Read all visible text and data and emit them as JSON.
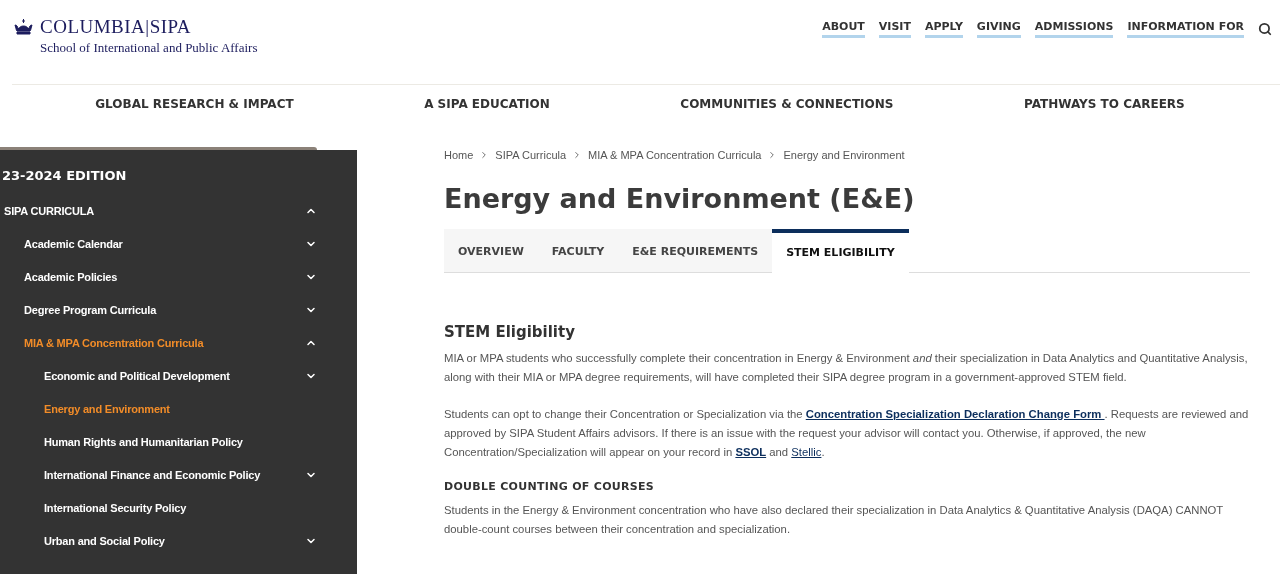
{
  "header": {
    "logo": {
      "wordmark": "COLUMBIA|SIPA",
      "subtitle": "School of International and Public Affairs"
    },
    "utility_nav": [
      "ABOUT",
      "VISIT",
      "APPLY",
      "GIVING",
      "ADMISSIONS",
      "INFORMATION FOR"
    ],
    "main_nav": [
      "GLOBAL RESEARCH & IMPACT",
      "A SIPA EDUCATION",
      "COMMUNITIES & CONNECTIONS",
      "PATHWAYS TO CAREERS"
    ]
  },
  "sidebar": {
    "edition": "23-2024 EDITION",
    "items": [
      {
        "label": "SIPA CURRICULA",
        "kind": "expandable",
        "expanded": true,
        "on_path": false,
        "children": [
          {
            "label": "Academic Calendar",
            "kind": "expandable",
            "expanded": false,
            "on_path": false
          },
          {
            "label": "Academic Policies",
            "kind": "expandable",
            "expanded": false,
            "on_path": false
          },
          {
            "label": "Degree Program Curricula",
            "kind": "expandable",
            "expanded": false,
            "on_path": false
          },
          {
            "label": "MIA & MPA Concentration Curricula",
            "kind": "expandable",
            "expanded": true,
            "on_path": true,
            "children": [
              {
                "label": "Economic and Political Development",
                "kind": "expandable",
                "expanded": false,
                "on_path": false
              },
              {
                "label": "Energy and Environment",
                "kind": "leaf",
                "on_path": true
              },
              {
                "label": "Human Rights and Humanitarian Policy",
                "kind": "leaf",
                "on_path": false
              },
              {
                "label": "International Finance and Economic Policy",
                "kind": "expandable",
                "expanded": false,
                "on_path": false
              },
              {
                "label": "International Security Policy",
                "kind": "leaf",
                "on_path": false
              },
              {
                "label": "Urban and Social Policy",
                "kind": "expandable",
                "expanded": false,
                "on_path": false
              }
            ]
          }
        ]
      }
    ]
  },
  "breadcrumb": [
    "Home",
    "SIPA Curricula",
    "MIA & MPA Concentration Curricula",
    "Energy and Environment"
  ],
  "title": "Energy and Environment (E&E)",
  "tabs": [
    {
      "label": "OVERVIEW",
      "selected": false
    },
    {
      "label": "FACULTY",
      "selected": false
    },
    {
      "label": "E&E REQUIREMENTS",
      "selected": false
    },
    {
      "label": "STEM ELIGIBILITY",
      "selected": true
    }
  ],
  "content": [
    {
      "kind": "heading",
      "text": "STEM Eligibility"
    },
    {
      "kind": "paragraph",
      "parts": [
        {
          "kind": "text",
          "text": "MIA or MPA students who successfully complete their concentration in Energy & Environment *and* their specialization in Data Analytics and Quantitative Analysis, along with their MIA or MPA degree requirements, will have completed their SIPA degree program in a government-approved STEM field."
        }
      ]
    },
    {
      "kind": "paragraph",
      "parts": [
        {
          "kind": "text",
          "text": "Students can opt to change their Concentration or Specialization via the "
        },
        {
          "kind": "link",
          "text": "Concentration Specialization Declaration Change Form ",
          "bold": true
        },
        {
          "kind": "text",
          "text": ". Requests are reviewed and approved by SIPA Student Affairs advisors. If there is an issue with the request your advisor will contact you. Otherwise, if approved, the new Concentration/Specialization will appear on your record in "
        },
        {
          "kind": "link",
          "text": "SSOL",
          "bold": true
        },
        {
          "kind": "text",
          "text": " and "
        },
        {
          "kind": "link",
          "text": "Stellic",
          "bold": false
        },
        {
          "kind": "text",
          "text": "."
        }
      ]
    },
    {
      "kind": "subheading",
      "text": "DOUBLE COUNTING OF COURSES"
    },
    {
      "kind": "paragraph",
      "parts": [
        {
          "kind": "text",
          "text": "Students in the Energy & Environment concentration who have also declared their specialization in Data Analytics & Quantitative Analysis (DAQA) CANNOT double-count courses between their concentration and specialization."
        }
      ]
    }
  ]
}
